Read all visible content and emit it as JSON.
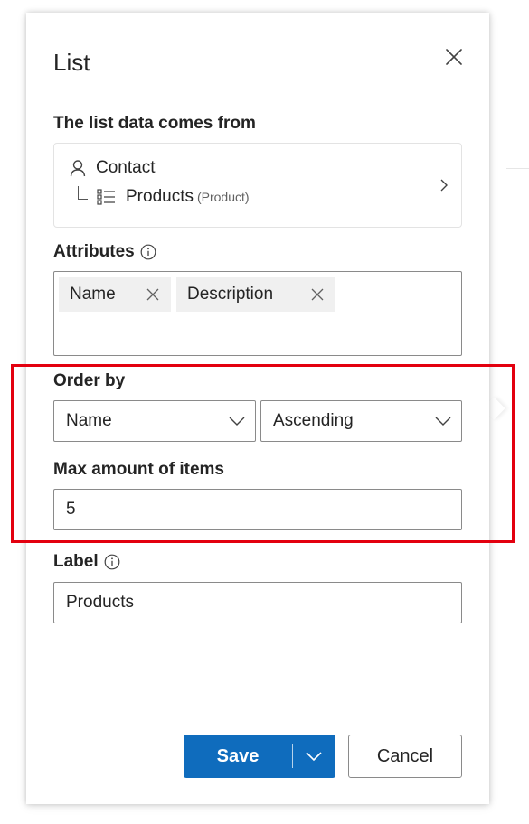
{
  "panel": {
    "title": "List"
  },
  "data_source": {
    "label": "The list data comes from",
    "root": "Contact",
    "child": "Products",
    "child_entity": "(Product)"
  },
  "attributes": {
    "label": "Attributes",
    "chips": [
      "Name",
      "Description"
    ]
  },
  "order_by": {
    "label": "Order by",
    "field_value": "Name",
    "direction_value": "Ascending"
  },
  "max_items": {
    "label": "Max amount of items",
    "value": "5"
  },
  "label_field": {
    "label": "Label",
    "value": "Products"
  },
  "footer": {
    "save_label": "Save",
    "cancel_label": "Cancel"
  },
  "colors": {
    "primary": "#0f6cbd",
    "highlight": "#e3000f"
  },
  "icons": [
    "close-icon",
    "person-icon",
    "list-icon",
    "chevron-right-icon",
    "info-icon",
    "dismiss-icon",
    "chevron-down-icon"
  ]
}
